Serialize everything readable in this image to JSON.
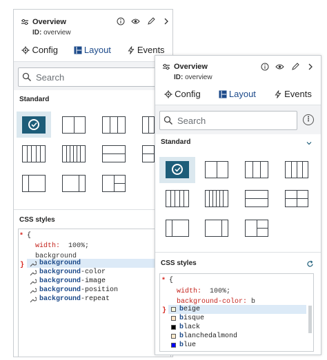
{
  "colors": {
    "accent": "#1d5d79",
    "tab_active": "#1c4a8a",
    "selected_bg": "#dbe8ef",
    "css_prop": "#c4231c",
    "marker": "#d6261f"
  },
  "component": {
    "title": "Overview",
    "id_label": "ID:",
    "id_value": "overview"
  },
  "tabs": [
    {
      "label": "Config",
      "icon": "gear-icon"
    },
    {
      "label": "Layout",
      "icon": "layout-grid-icon",
      "active": true
    },
    {
      "label": "Events",
      "icon": "lightning-icon"
    }
  ],
  "search": {
    "placeholder": "Search"
  },
  "standard_section": {
    "title": "Standard"
  },
  "css_section": {
    "title": "CSS styles"
  },
  "back_panel": {
    "code": {
      "brace_open": "{",
      "line1_prop": "width:",
      "line1_val": " 100%;",
      "line2_text": "background",
      "brace_close": "}"
    },
    "autocomplete": [
      {
        "prefix": "background",
        "suffix": ""
      },
      {
        "prefix": "background",
        "suffix": "-color"
      },
      {
        "prefix": "background",
        "suffix": "-image"
      },
      {
        "prefix": "background",
        "suffix": "-position"
      },
      {
        "prefix": "background",
        "suffix": "-repeat"
      }
    ]
  },
  "front_panel": {
    "code": {
      "brace_open": "{",
      "line1_prop": "width:",
      "line1_val": " 100%;",
      "line2_prop": "background-color:",
      "line2_val": " b",
      "brace_close": "}"
    },
    "autocomplete": [
      {
        "prefix": "b",
        "suffix": "eige",
        "swatch": "#f5f5dc"
      },
      {
        "prefix": "b",
        "suffix": "isque",
        "swatch": "#ffe4c4"
      },
      {
        "prefix": "b",
        "suffix": "lack",
        "swatch": "#000000"
      },
      {
        "prefix": "b",
        "suffix": "lanchedalmond",
        "swatch": "#ffebcd"
      },
      {
        "prefix": "b",
        "suffix": "lue",
        "swatch": "#0000ff"
      }
    ]
  }
}
